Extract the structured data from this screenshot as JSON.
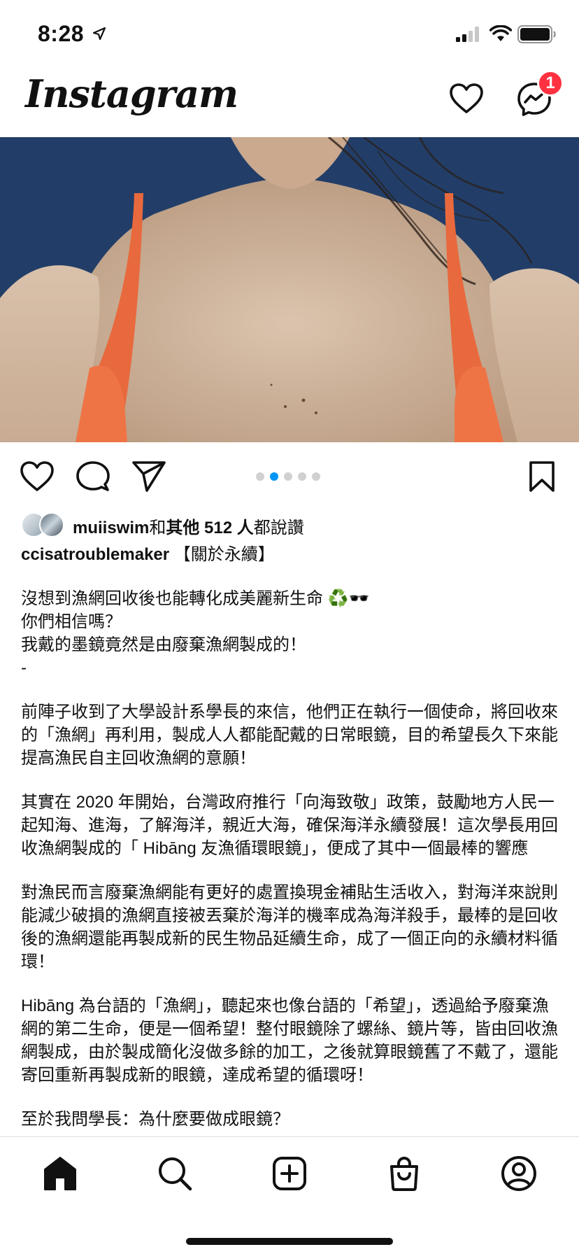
{
  "status_bar": {
    "time": "8:28",
    "icons": [
      "location-arrow-icon",
      "cellular-signal-icon",
      "wifi-icon",
      "battery-icon"
    ]
  },
  "header": {
    "logo_text": "Instagram",
    "notifications_icon": "heart-icon",
    "messenger_icon": "messenger-icon",
    "messenger_badge": "1"
  },
  "post": {
    "carousel": {
      "total": 5,
      "active_index": 1
    },
    "actions": [
      "like-icon",
      "comment-icon",
      "share-icon",
      "bookmark-icon"
    ],
    "likes": {
      "user": "muiiswim",
      "joiner": "和",
      "others": "其他 512 人",
      "suffix": "都說讚"
    },
    "caption": {
      "username": "ccisatroublemaker",
      "title": " 【關於永續】",
      "paragraphs": [
        "沒想到漁網回收後也能轉化成美麗新生命 ♻️🕶️\n你們相信嗎？\n我戴的墨鏡竟然是由廢棄漁網製成的！\n-",
        "前陣子收到了大學設計系學長的來信，他們正在執行一個使命，將回收來的「漁網」再利用，製成人人都能配戴的日常眼鏡，目的希望長久下來能提高漁民自主回收漁網的意願！",
        "其實在 2020 年開始，台灣政府推行「向海致敬」政策，鼓勵地方人民一起知海、進海，了解海洋，親近大海，確保海洋永續發展！這次學長用回收漁網製成的「 Hibāng 友漁循環眼鏡」，便成了其中一個最棒的響應",
        "對漁民而言廢棄漁網能有更好的處置換現金補貼生活收入，對海洋來說則能減少破損的漁網直接被丟棄於海洋的機率成為海洋殺手，最棒的是回收後的漁網還能再製成新的民生物品延續生命，成了一個正向的永續材料循環！",
        "Hibāng 為台語的「漁網」，聽起來也像台語的「希望」，透過給予廢棄漁網的第二生命，便是一個希望！整付眼鏡除了螺絲、鏡片等，皆由回收漁網製成，由於製成簡化沒做多餘的加工，之後就算眼鏡舊了不戴了，還能寄回重新再製成新的眼鏡，達成希望的循環呀！",
        "至於我問學長：為什麼要做成眼鏡？"
      ]
    }
  },
  "bottom_nav": {
    "items": [
      "home-icon",
      "search-icon",
      "new-post-icon",
      "shop-icon",
      "profile-icon"
    ]
  },
  "colors": {
    "badge": "#ff3040",
    "active_dot": "#0095f6",
    "inactive_dot": "#d0d0d0",
    "text": "#111111"
  }
}
